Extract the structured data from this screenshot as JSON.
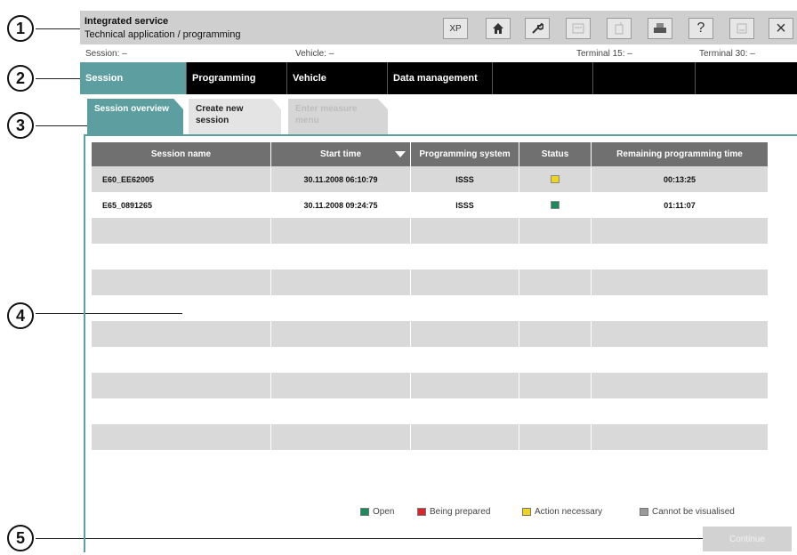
{
  "callouts": [
    "1",
    "2",
    "3",
    "4",
    "5"
  ],
  "titlebar": {
    "line1": "Integrated service",
    "line2": "Technical application / programming",
    "buttons": [
      "XP",
      "home-icon",
      "wrench-icon",
      "card-icon",
      "phone-icon",
      "print-icon",
      "?",
      "window-icon",
      "×"
    ]
  },
  "info": {
    "session": "Session:  –",
    "vehicle": "Vehicle:  –",
    "terminal15": "Terminal 15:  –",
    "terminal30": "Terminal 30:  –"
  },
  "nav": {
    "tabs": [
      "Session",
      "Programming",
      "Vehicle",
      "Data management",
      "",
      "",
      ""
    ]
  },
  "subtabs": [
    {
      "label": "Session overview",
      "state": "active"
    },
    {
      "label": "Create new session",
      "state": "normal"
    },
    {
      "label": "Enter measure menu",
      "state": "disabled"
    }
  ],
  "table": {
    "headers": [
      "Session name",
      "Start time",
      "Programming system",
      "Status",
      "Remaining programming time"
    ],
    "rows": [
      {
        "name": "E60_EE62005",
        "start": "30.11.2008 06:10:79",
        "system": "ISSS",
        "status_color": "#f0d31e",
        "remaining": "00:13:25"
      },
      {
        "name": "E65_0891265",
        "start": "30.11.2008 09:24:75",
        "system": "ISSS",
        "status_color": "#1c8a5a",
        "remaining": "01:11:07"
      }
    ],
    "empty_rows": 10
  },
  "legend": [
    {
      "label": "Open",
      "color": "#1c8a5a"
    },
    {
      "label": "Being prepared",
      "color": "#d6262b"
    },
    {
      "label": "Action necessary",
      "color": "#f0d31e"
    },
    {
      "label": "Cannot be visualised",
      "color": "#9a9a9a"
    }
  ],
  "continue_label": "Continue",
  "colors": {
    "accent": "#5d9ea0",
    "nav_bg": "#000000",
    "header_bg": "#707070",
    "row_alt": "#d9d9d9"
  }
}
